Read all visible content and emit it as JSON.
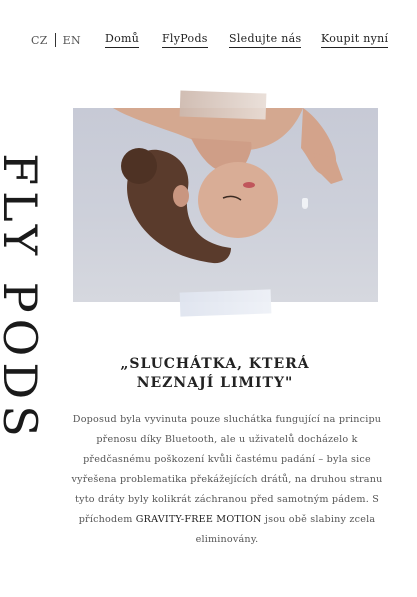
{
  "nav": {
    "lang_cz": "CZ",
    "lang_en": "EN",
    "items": [
      "Domů",
      "FlyPods",
      "Sledujte nás",
      "Koupit nyní"
    ]
  },
  "vertical_title": "FLY PODS",
  "quote": "„SLUCHÁTKA, KTERÁ NEZNAJÍ LIMITY\"",
  "body_text_before": "Doposud byla vyvinuta pouze sluchátka fungující na principu přenosu díky Bluetooth, ale u uživatelů docházelo k předčasnému poškození kvůli častému padání – byla sice vyřešena problematika překážejících drátů, na druhou stranu tyto dráty byly kolikrát záchranou před samotným pádem. S příchodem",
  "body_text_strong": "GRAVITY-FREE MOTION",
  "body_text_after": "jsou obě slabiny zcela eliminovány.",
  "colors": {
    "background": "#ffffff",
    "text": "#2a2a2a"
  }
}
